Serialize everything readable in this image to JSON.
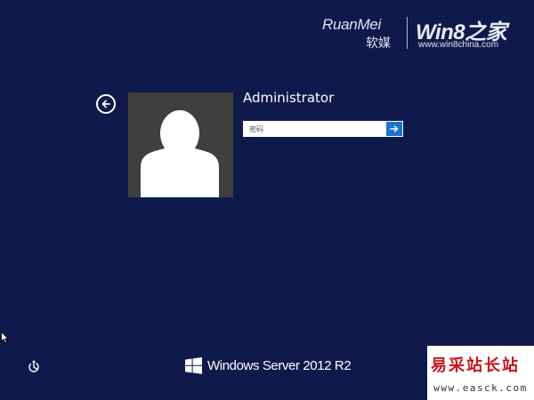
{
  "watermark_top": {
    "ruanmei": "RuanMei",
    "ruanmei_cn": "软媒",
    "brand": "Win8之家",
    "url": "www.win8china.com"
  },
  "login": {
    "username": "Administrator",
    "password_placeholder": "密码",
    "password_value": ""
  },
  "icons": {
    "back": "back-arrow-icon",
    "submit": "arrow-right-icon",
    "ease_of_access": "ease-of-access-icon",
    "logo": "windows-logo-icon",
    "avatar": "user-silhouette-icon"
  },
  "branding": {
    "product": "Windows Server 2012 R2"
  },
  "watermark_bottom": {
    "text": "易采站长站",
    "url": "www.easck.com"
  },
  "colors": {
    "background": "#0e1a4b",
    "submit_button": "#1c73d1",
    "tile": "#3f3f3f",
    "watermark_red": "#c8141c"
  }
}
